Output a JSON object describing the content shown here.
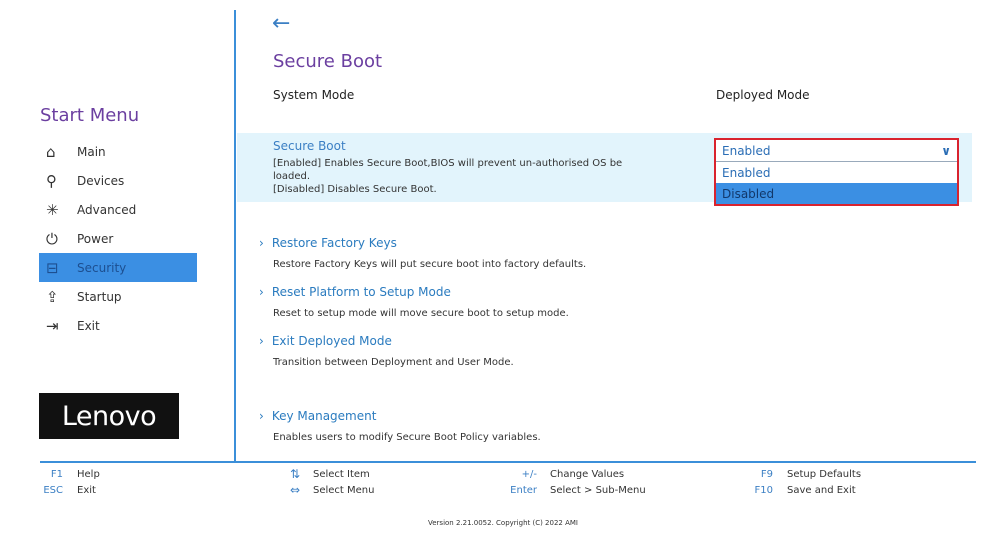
{
  "sidebar": {
    "title": "Start Menu",
    "items": [
      {
        "label": "Main",
        "icon": "home-icon"
      },
      {
        "label": "Devices",
        "icon": "devices-icon"
      },
      {
        "label": "Advanced",
        "icon": "advanced-icon"
      },
      {
        "label": "Power",
        "icon": "power-icon"
      },
      {
        "label": "Security",
        "icon": "lock-icon",
        "selected": true
      },
      {
        "label": "Startup",
        "icon": "startup-icon"
      },
      {
        "label": "Exit",
        "icon": "exit-icon"
      }
    ],
    "logo": "Lenovo"
  },
  "page": {
    "title": "Secure Boot",
    "system_mode_label": "System Mode",
    "system_mode_value": "Deployed Mode"
  },
  "secure_boot": {
    "label": "Secure Boot",
    "desc1": "[Enabled] Enables Secure Boot,BIOS will prevent un-authorised OS be loaded.",
    "desc2": "[Disabled] Disables Secure Boot.",
    "value": "Enabled",
    "options": [
      "Enabled",
      "Disabled"
    ]
  },
  "links": [
    {
      "label": "Restore Factory Keys",
      "desc": "Restore Factory Keys will put secure boot into factory defaults."
    },
    {
      "label": "Reset Platform to Setup Mode",
      "desc": "Reset to setup mode will move secure boot to setup mode."
    },
    {
      "label": "Exit Deployed Mode",
      "desc": "Transition between Deployment and User Mode."
    },
    {
      "label": "Key Management",
      "desc": "Enables users to modify Secure Boot Policy variables."
    }
  ],
  "footer": {
    "keys": [
      {
        "key": "F1",
        "label": "Help"
      },
      {
        "key": "ESC",
        "label": "Exit"
      },
      {
        "key": "⇅",
        "label": "Select Item"
      },
      {
        "key": "⇔",
        "label": "Select Menu"
      },
      {
        "key": "+/-",
        "label": "Change Values"
      },
      {
        "key": "Enter",
        "label": "Select > Sub-Menu"
      },
      {
        "key": "F9",
        "label": "Setup Defaults"
      },
      {
        "key": "F10",
        "label": "Save and Exit"
      }
    ],
    "version": "Version 2.21.0052. Copyright (C) 2022 AMI"
  }
}
